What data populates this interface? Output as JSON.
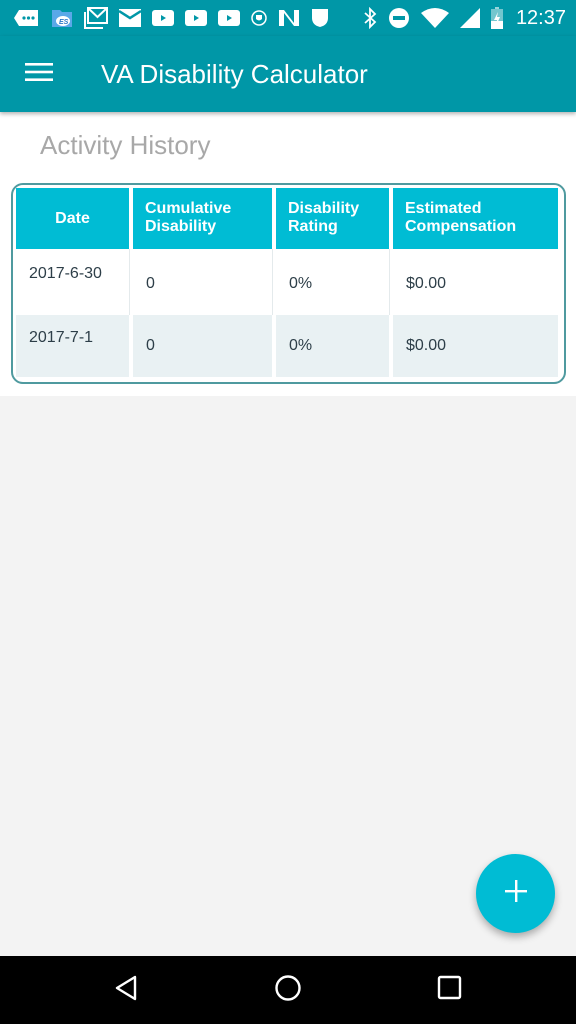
{
  "status_bar": {
    "time": "12:37",
    "left_icons": [
      "messages-icon",
      "file-explorer-icon",
      "gmail-icon",
      "email-icon",
      "youtube-icon",
      "youtube-icon",
      "youtube-icon",
      "security-shield-icon",
      "n-app-icon",
      "shield-icon"
    ],
    "right_icons": [
      "bluetooth-icon",
      "do-not-disturb-icon",
      "wifi-icon",
      "cell-signal-icon",
      "battery-charging-icon"
    ]
  },
  "app_bar": {
    "title": "VA Disability Calculator",
    "menu_icon": "hamburger-menu-icon"
  },
  "section": {
    "title": "Activity History"
  },
  "table": {
    "headers": [
      "Date",
      "Cumulative Disability",
      "Disability Rating",
      "Estimated Compensation"
    ],
    "rows": [
      {
        "date": "2017-6-30",
        "cumulative": "0",
        "rating": "0%",
        "compensation": "$0.00"
      },
      {
        "date": "2017-7-1",
        "cumulative": "0",
        "rating": "0%",
        "compensation": "$0.00"
      }
    ]
  },
  "fab": {
    "icon": "plus-icon",
    "action": "add"
  },
  "nav_bar": {
    "buttons": [
      "back-icon",
      "home-icon",
      "recents-icon"
    ]
  },
  "colors": {
    "primary": "#0097a7",
    "accent": "#00bcd4",
    "table_border": "#4f9a9f",
    "alt_row": "#e9f1f3",
    "section_title": "#a8a8a8"
  }
}
